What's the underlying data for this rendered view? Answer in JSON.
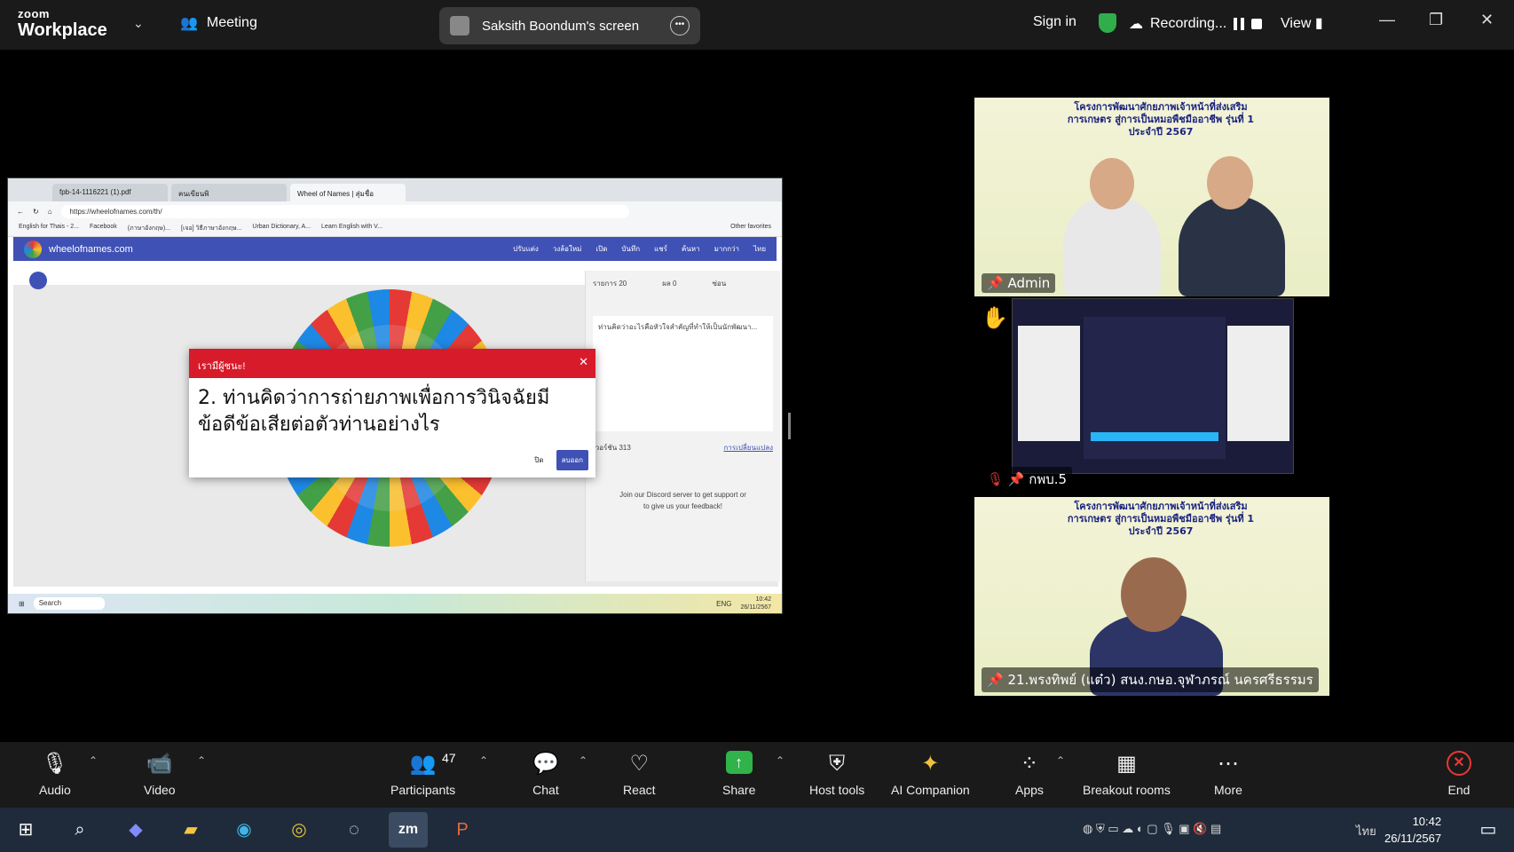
{
  "app": {
    "logo_line1": "zoom",
    "logo_line2": "Workplace",
    "meeting_label": "Meeting",
    "share_pill_text": "Saksith Boondum's screen",
    "sign_in": "Sign in",
    "recording": "Recording...",
    "view": "View"
  },
  "shared_screen": {
    "tabs": [
      "fpb-14-1116221 (1).pdf",
      "คนเขียนพิ",
      "Wheel of Names | สุ่มชื่อ"
    ],
    "url": "https://wheelofnames.com/th/",
    "bookmarks": [
      "English for Thais - 2...",
      "Facebook",
      "(ภาษาอังกฤษ)...",
      "[เจอ] วิธีภาษาอังกฤษ...",
      "Urban Dictionary, A...",
      "Learn English with V...",
      "Other favorites"
    ],
    "site_name": "wheelofnames.com",
    "site_menus": [
      "ปรับแต่ง",
      "วงล้อใหม่",
      "เปิด",
      "บันทึก",
      "แชร์",
      "ค้นหา",
      "มากกว่า",
      "ไทย"
    ],
    "dialog_header": "เรามีผู้ชนะ!",
    "dialog_text": "2. ท่านคิดว่าการถ่ายภาพเพื่อการวินิจฉัยมีข้อดีข้อเสียต่อตัวท่านอย่างไร",
    "dialog_close_btn": "ปิด",
    "dialog_ok_btn": "ลบออก",
    "panel_tabs": "รายการ 20",
    "panel_results": "ผล 0",
    "panel_hidden": "ซ่อน",
    "panel_text": "ท่านคิดว่าอะไรคือหัวใจสำคัญที่ทำให้เป็นนักพัฒนา...",
    "panel_version": "เวอร์ชัน 313",
    "panel_changes": "การเปลี่ยนแปลง",
    "discord_text": "Join our Discord server to get support or to give us your feedback!",
    "taskbar_search": "Search",
    "taskbar_lang": "ENG",
    "taskbar_time": "10:42",
    "taskbar_date": "26/11/2567"
  },
  "tiles": [
    {
      "banner": "โครงการพัฒนาศักยภาพเจ้าหน้าที่ส่งเสริมการเกษตร สู่การเป็นหมอพืชมืออาชีพ รุ่นที่ 1 ประจำปี 2567",
      "name": "Admin"
    },
    {
      "name": "กพบ.5"
    },
    {
      "banner": "โครงการพัฒนาศักยภาพเจ้าหน้าที่ส่งเสริมการเกษตร สู่การเป็นหมอพืชมืออาชีพ รุ่นที่ 1 ประจำปี 2567",
      "name": "21.พรงทิพย์ (แต๋ว) สนง.กษอ.จุฬาภรณ์ นครศรีธรรมร"
    }
  ],
  "toolbar": {
    "audio": "Audio",
    "video": "Video",
    "participants": "Participants",
    "participants_count": "47",
    "chat": "Chat",
    "react": "React",
    "share": "Share",
    "host_tools": "Host tools",
    "ai_companion": "AI Companion",
    "apps": "Apps",
    "breakout_rooms": "Breakout rooms",
    "more": "More",
    "end": "End"
  },
  "taskbar": {
    "zm_label": "zm",
    "time": "10:42",
    "date": "26/11/2567",
    "lang": "ไทย"
  },
  "colors": {
    "share_green": "#2fb34a",
    "end_red": "#e53935",
    "dialog_red": "#d81b2a",
    "won_blue": "#3f51b5"
  }
}
